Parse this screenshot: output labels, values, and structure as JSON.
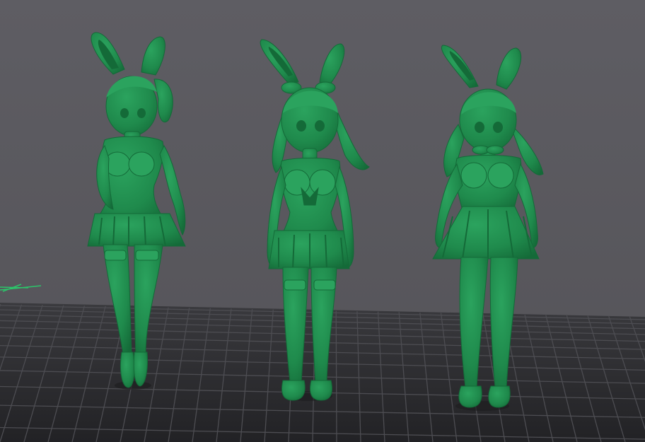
{
  "scene": {
    "colors": {
      "background": "#5b5a5f",
      "bed_floor": "#2b2b2e",
      "bed_grid": "#4d4d52",
      "model_main": "#1f8a4c",
      "model_shadow": "#146a38",
      "model_highlight": "#2ba35e",
      "origin_axis": "#2cc46a"
    },
    "models": [
      {
        "name": "bunny-figure-left"
      },
      {
        "name": "bunny-figure-center"
      },
      {
        "name": "bunny-figure-right"
      }
    ]
  }
}
